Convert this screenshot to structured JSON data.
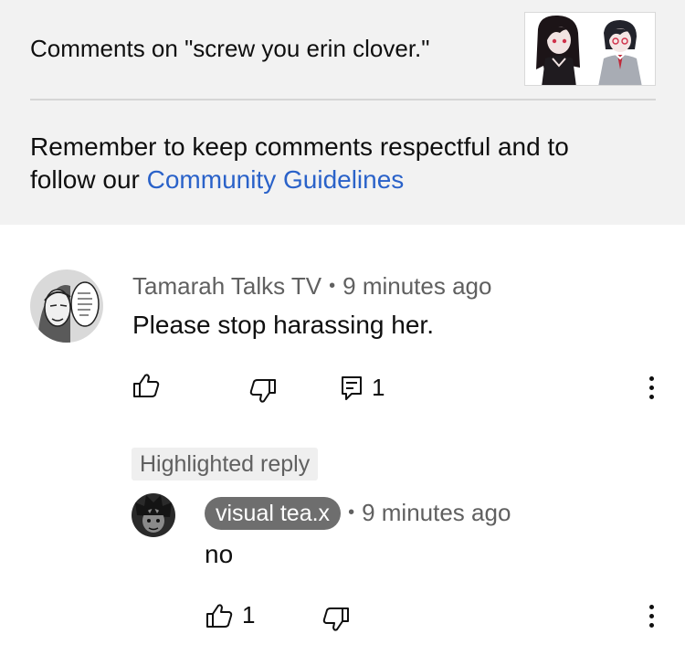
{
  "header": {
    "title": "Comments on \"screw you erin clover.\"",
    "thumbnail_icon": "video-thumbnail-two-anime-characters",
    "reminder_text": "Remember to keep comments respectful and to follow our ",
    "guidelines_link": "Community Guidelines",
    "link_color": "#2a62c9"
  },
  "comment": {
    "author": "Tamarah Talks TV",
    "time": "9 minutes ago",
    "text": "Please stop harassing her.",
    "replies_count": "1",
    "avatar_icon": "manga-character-avatar"
  },
  "reply": {
    "highlight_label": "Highlighted reply",
    "author": "visual tea.x",
    "time": "9 minutes ago",
    "text": "no",
    "likes_count": "1",
    "avatar_icon": "anime-character-avatar"
  },
  "separator": "•"
}
